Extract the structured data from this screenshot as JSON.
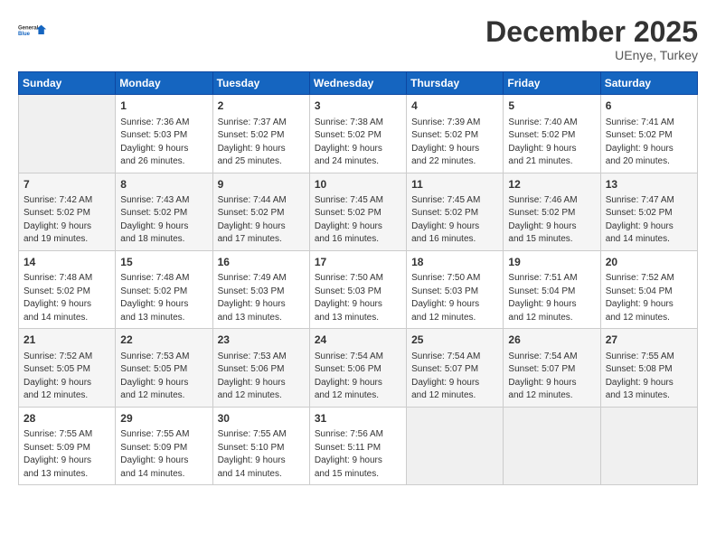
{
  "header": {
    "logo_line1": "General",
    "logo_line2": "Blue",
    "title": "December 2025",
    "subtitle": "UEnye, Turkey"
  },
  "weekdays": [
    "Sunday",
    "Monday",
    "Tuesday",
    "Wednesday",
    "Thursday",
    "Friday",
    "Saturday"
  ],
  "weeks": [
    [
      {
        "num": "",
        "empty": true
      },
      {
        "num": "1",
        "rise": "7:36 AM",
        "set": "5:03 PM",
        "daylight": "9 hours and 26 minutes."
      },
      {
        "num": "2",
        "rise": "7:37 AM",
        "set": "5:02 PM",
        "daylight": "9 hours and 25 minutes."
      },
      {
        "num": "3",
        "rise": "7:38 AM",
        "set": "5:02 PM",
        "daylight": "9 hours and 24 minutes."
      },
      {
        "num": "4",
        "rise": "7:39 AM",
        "set": "5:02 PM",
        "daylight": "9 hours and 22 minutes."
      },
      {
        "num": "5",
        "rise": "7:40 AM",
        "set": "5:02 PM",
        "daylight": "9 hours and 21 minutes."
      },
      {
        "num": "6",
        "rise": "7:41 AM",
        "set": "5:02 PM",
        "daylight": "9 hours and 20 minutes."
      }
    ],
    [
      {
        "num": "7",
        "rise": "7:42 AM",
        "set": "5:02 PM",
        "daylight": "9 hours and 19 minutes."
      },
      {
        "num": "8",
        "rise": "7:43 AM",
        "set": "5:02 PM",
        "daylight": "9 hours and 18 minutes."
      },
      {
        "num": "9",
        "rise": "7:44 AM",
        "set": "5:02 PM",
        "daylight": "9 hours and 17 minutes."
      },
      {
        "num": "10",
        "rise": "7:45 AM",
        "set": "5:02 PM",
        "daylight": "9 hours and 16 minutes."
      },
      {
        "num": "11",
        "rise": "7:45 AM",
        "set": "5:02 PM",
        "daylight": "9 hours and 16 minutes."
      },
      {
        "num": "12",
        "rise": "7:46 AM",
        "set": "5:02 PM",
        "daylight": "9 hours and 15 minutes."
      },
      {
        "num": "13",
        "rise": "7:47 AM",
        "set": "5:02 PM",
        "daylight": "9 hours and 14 minutes."
      }
    ],
    [
      {
        "num": "14",
        "rise": "7:48 AM",
        "set": "5:02 PM",
        "daylight": "9 hours and 14 minutes."
      },
      {
        "num": "15",
        "rise": "7:48 AM",
        "set": "5:02 PM",
        "daylight": "9 hours and 13 minutes."
      },
      {
        "num": "16",
        "rise": "7:49 AM",
        "set": "5:03 PM",
        "daylight": "9 hours and 13 minutes."
      },
      {
        "num": "17",
        "rise": "7:50 AM",
        "set": "5:03 PM",
        "daylight": "9 hours and 13 minutes."
      },
      {
        "num": "18",
        "rise": "7:50 AM",
        "set": "5:03 PM",
        "daylight": "9 hours and 12 minutes."
      },
      {
        "num": "19",
        "rise": "7:51 AM",
        "set": "5:04 PM",
        "daylight": "9 hours and 12 minutes."
      },
      {
        "num": "20",
        "rise": "7:52 AM",
        "set": "5:04 PM",
        "daylight": "9 hours and 12 minutes."
      }
    ],
    [
      {
        "num": "21",
        "rise": "7:52 AM",
        "set": "5:05 PM",
        "daylight": "9 hours and 12 minutes."
      },
      {
        "num": "22",
        "rise": "7:53 AM",
        "set": "5:05 PM",
        "daylight": "9 hours and 12 minutes."
      },
      {
        "num": "23",
        "rise": "7:53 AM",
        "set": "5:06 PM",
        "daylight": "9 hours and 12 minutes."
      },
      {
        "num": "24",
        "rise": "7:54 AM",
        "set": "5:06 PM",
        "daylight": "9 hours and 12 minutes."
      },
      {
        "num": "25",
        "rise": "7:54 AM",
        "set": "5:07 PM",
        "daylight": "9 hours and 12 minutes."
      },
      {
        "num": "26",
        "rise": "7:54 AM",
        "set": "5:07 PM",
        "daylight": "9 hours and 12 minutes."
      },
      {
        "num": "27",
        "rise": "7:55 AM",
        "set": "5:08 PM",
        "daylight": "9 hours and 13 minutes."
      }
    ],
    [
      {
        "num": "28",
        "rise": "7:55 AM",
        "set": "5:09 PM",
        "daylight": "9 hours and 13 minutes."
      },
      {
        "num": "29",
        "rise": "7:55 AM",
        "set": "5:09 PM",
        "daylight": "9 hours and 14 minutes."
      },
      {
        "num": "30",
        "rise": "7:55 AM",
        "set": "5:10 PM",
        "daylight": "9 hours and 14 minutes."
      },
      {
        "num": "31",
        "rise": "7:56 AM",
        "set": "5:11 PM",
        "daylight": "9 hours and 15 minutes."
      },
      {
        "num": "",
        "empty": true
      },
      {
        "num": "",
        "empty": true
      },
      {
        "num": "",
        "empty": true
      }
    ]
  ]
}
